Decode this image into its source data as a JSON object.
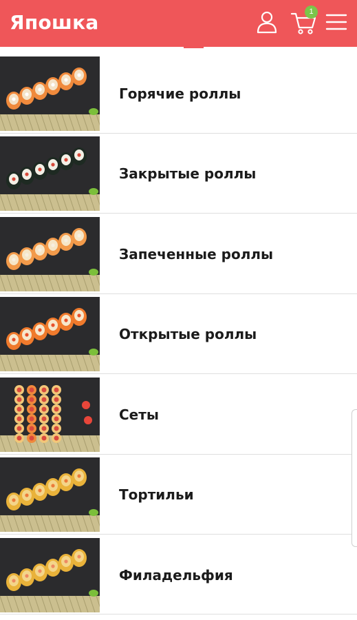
{
  "header": {
    "brand": "Япошка",
    "cart_count": "1",
    "brand_color": "#ef5659",
    "badge_color": "#7cc54a",
    "icons": [
      "user-icon",
      "cart-icon",
      "hamburger-menu-icon"
    ]
  },
  "categories": [
    {
      "label": "Горячие роллы",
      "image": "hot-rolls-image"
    },
    {
      "label": "Закрытые роллы",
      "image": "closed-rolls-image"
    },
    {
      "label": "Запеченные роллы",
      "image": "baked-rolls-image"
    },
    {
      "label": "Открытые роллы",
      "image": "open-rolls-image"
    },
    {
      "label": "Сеты",
      "image": "sets-image"
    },
    {
      "label": "Тортильи",
      "image": "tortilla-image"
    },
    {
      "label": "Филадельфия",
      "image": "philadelphia-image"
    }
  ]
}
